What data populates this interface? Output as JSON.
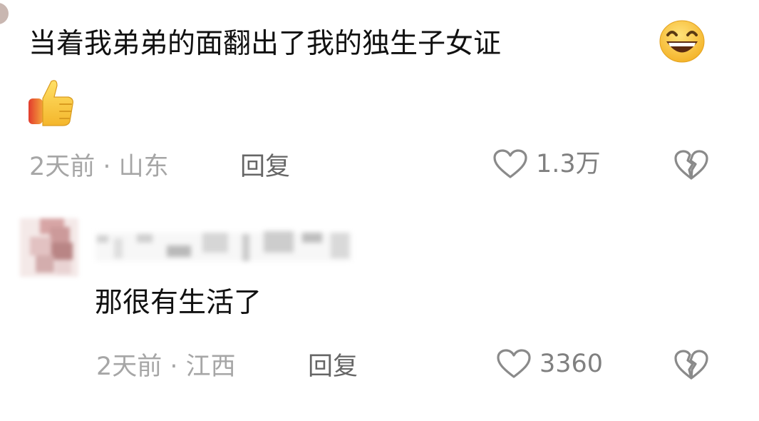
{
  "comments": [
    {
      "text": "当着我弟弟的面翻出了我的独生子女证",
      "emoji_inline": "grinning-face-icon",
      "emoji_block": "thumbs-up-icon",
      "time_location": "2天前 · 山东",
      "reply_label": "回复",
      "like_count": "1.3万"
    },
    {
      "text": "那很有生活了",
      "time_location": "2天前 · 江西",
      "reply_label": "回复",
      "like_count": "3360"
    }
  ],
  "colors": {
    "text": "#111111",
    "meta": "#a6a6a6",
    "reply": "#666666",
    "icon": "#8a8a8a"
  }
}
